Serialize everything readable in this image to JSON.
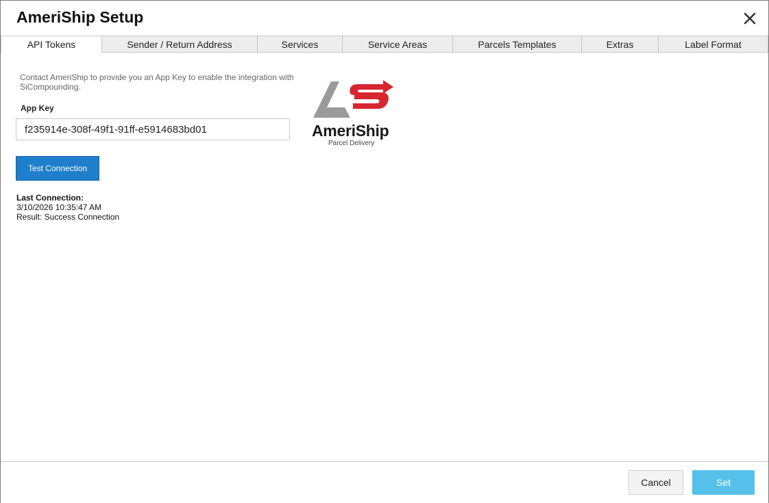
{
  "window": {
    "title": "AmeriShip Setup",
    "close_icon": "close-icon"
  },
  "tabs": [
    {
      "label": "API Tokens",
      "active": true
    },
    {
      "label": "Sender / Return Address",
      "active": false
    },
    {
      "label": "Services",
      "active": false
    },
    {
      "label": "Service Areas",
      "active": false
    },
    {
      "label": "Parcels Templates",
      "active": false
    },
    {
      "label": "Extras",
      "active": false
    },
    {
      "label": "Label Format",
      "active": false
    }
  ],
  "api_tokens": {
    "info_text": "Contact AmeriShip to provide you an App Key to enable the integration with SiCompounding.",
    "app_key_label": "App Key",
    "app_key_value": "f235914e-308f-49f1-91ff-e5914683bd01",
    "test_button_label": "Test Connection",
    "last_connection_label": "Last Connection:",
    "last_connection_time": "3/10/2026 10:35:47 AM",
    "result_text": "Result: Success Connection"
  },
  "logo": {
    "wordmark": "AmeriShip",
    "tagline": "Parcel Delivery",
    "colors": {
      "gray": "#9a9a9a",
      "red": "#d6262f"
    }
  },
  "footer": {
    "cancel_label": "Cancel",
    "set_label": "Set"
  },
  "colors": {
    "primary_button": "#1f7fcc",
    "set_button": "#55c1ea",
    "tab_inactive_bg": "#ededed"
  }
}
